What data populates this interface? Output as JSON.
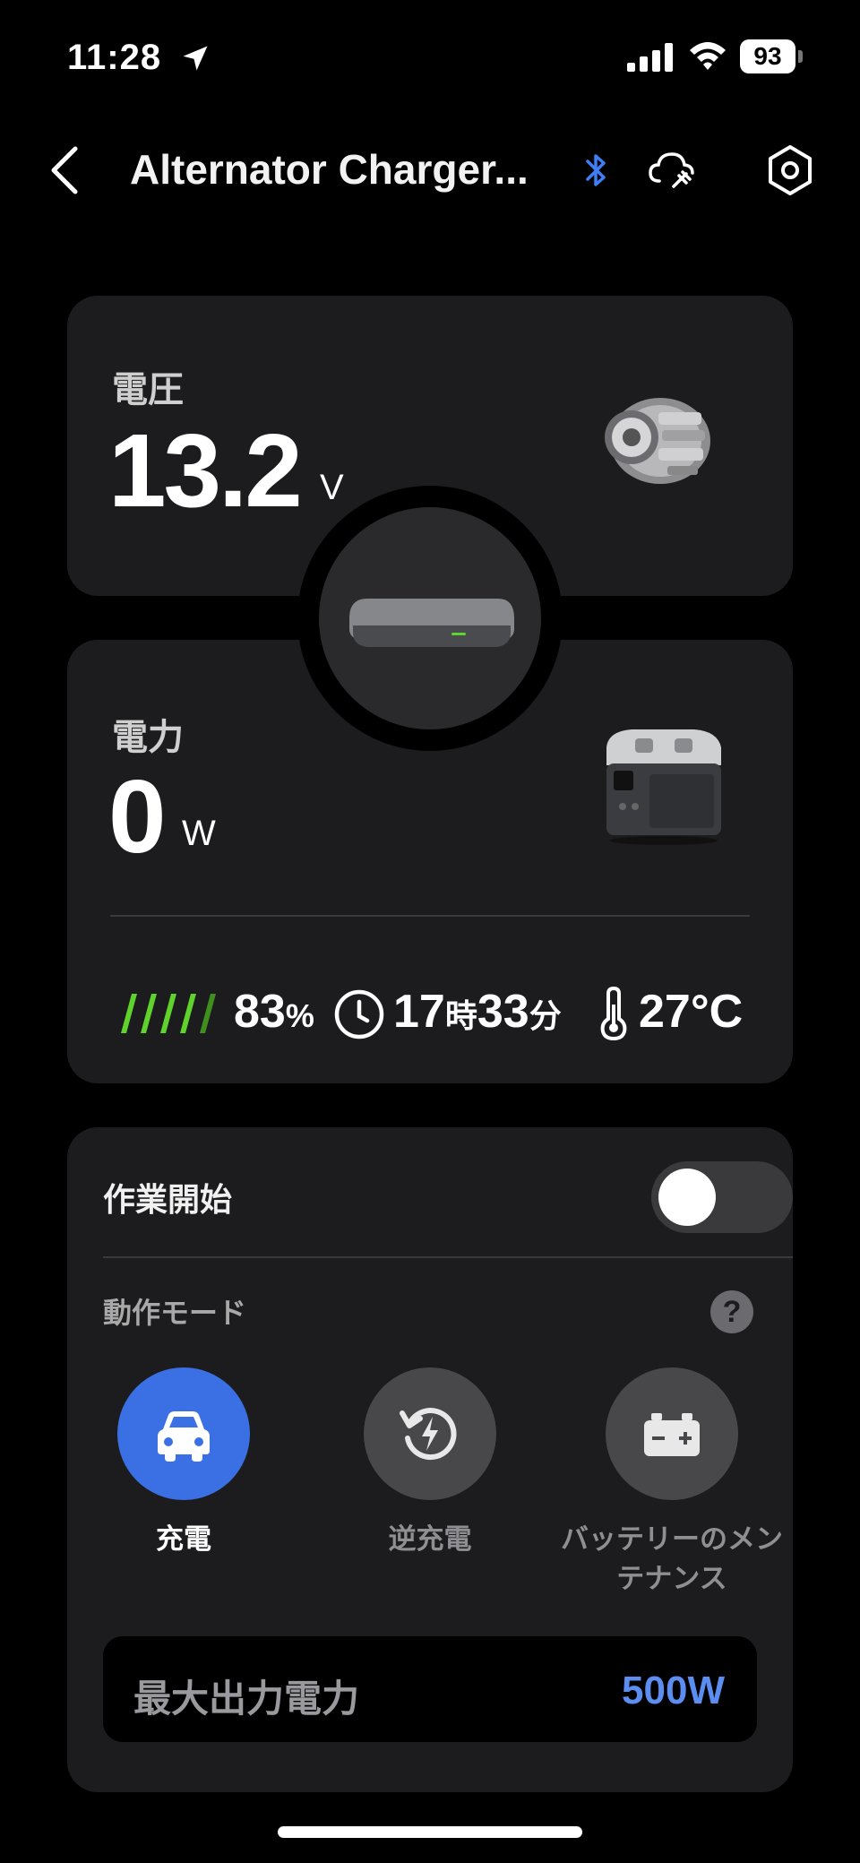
{
  "status_bar": {
    "time": "11:28",
    "battery_level": "93",
    "icons": [
      "location-arrow-icon",
      "cellular-signal-icon",
      "wifi-icon",
      "battery-icon"
    ]
  },
  "header": {
    "title": "Alternator Charger...",
    "icons": [
      "back-chevron-icon",
      "bluetooth-icon",
      "cloud-plug-icon",
      "settings-hexagon-icon"
    ]
  },
  "voltage_card": {
    "label": "電圧",
    "value": "13.2",
    "unit": "V"
  },
  "power_card": {
    "label": "電力",
    "value": "0",
    "unit": "W",
    "battery_percent": "83",
    "percent_unit": "%",
    "hours": "17",
    "hours_unit": "時",
    "minutes": "33",
    "minutes_unit": "分",
    "temperature": "27°C"
  },
  "operations": {
    "start_label": "作業開始",
    "start_toggle_on": false,
    "mode_section_label": "動作モード",
    "help_symbol": "?",
    "modes": [
      {
        "label": "充電",
        "icon": "car-icon",
        "active": true
      },
      {
        "label": "逆充電",
        "icon": "reverse-charge-icon",
        "active": false
      },
      {
        "label": "バッテリーのメンテナンス",
        "icon": "car-battery-icon",
        "active": false
      }
    ],
    "max_output_label": "最大出力電力",
    "max_output_value": "500W"
  },
  "colors": {
    "accent_blue": "#3a70e3",
    "value_blue": "#5b8ef0",
    "battery_green": "#5fd32b",
    "card_bg": "#1c1c1e",
    "bluetooth_blue": "#3f7ef5"
  }
}
